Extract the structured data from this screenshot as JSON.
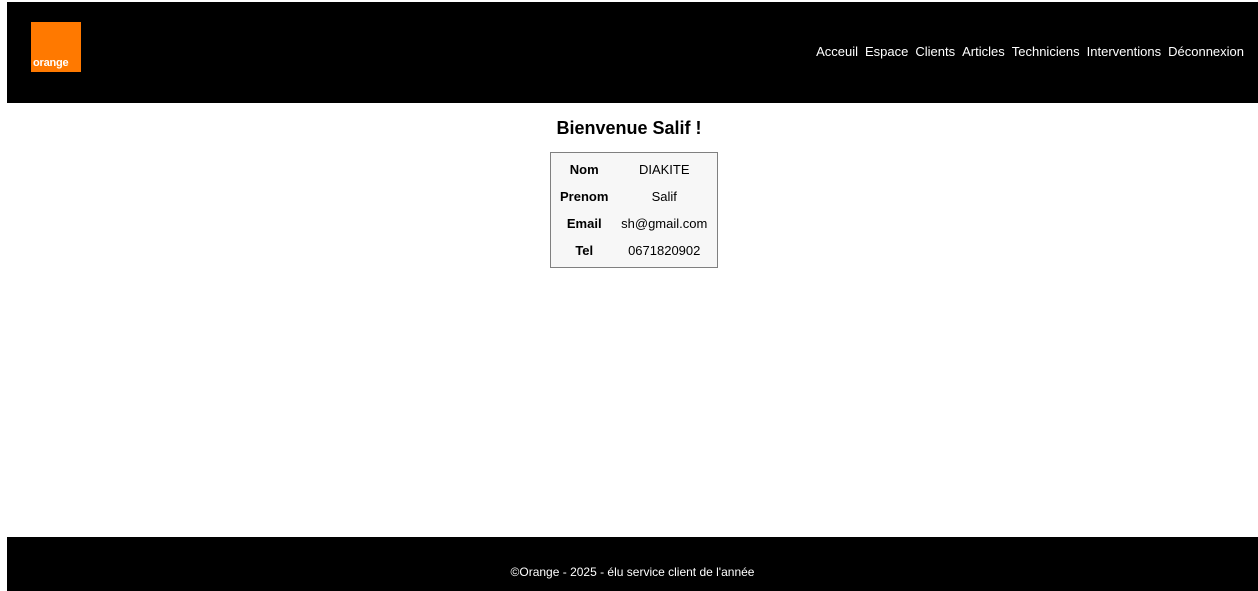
{
  "header": {
    "logo_text": "orange",
    "nav": [
      {
        "label": "Acceuil"
      },
      {
        "label": "Espace"
      },
      {
        "label": "Clients"
      },
      {
        "label": "Articles"
      },
      {
        "label": "Techniciens"
      },
      {
        "label": "Interventions"
      },
      {
        "label": "Déconnexion"
      }
    ]
  },
  "main": {
    "title": "Bienvenue Salif !",
    "profile": [
      {
        "label": "Nom",
        "value": "DIAKITE"
      },
      {
        "label": "Prenom",
        "value": "Salif"
      },
      {
        "label": "Email",
        "value": "sh@gmail.com"
      },
      {
        "label": "Tel",
        "value": "0671820902"
      }
    ]
  },
  "footer": {
    "text": "©Orange - 2025 - élu service client de l'année"
  },
  "colors": {
    "brand": "#ff7900",
    "header_bg": "#000000",
    "table_bg": "#f7f7f7"
  }
}
